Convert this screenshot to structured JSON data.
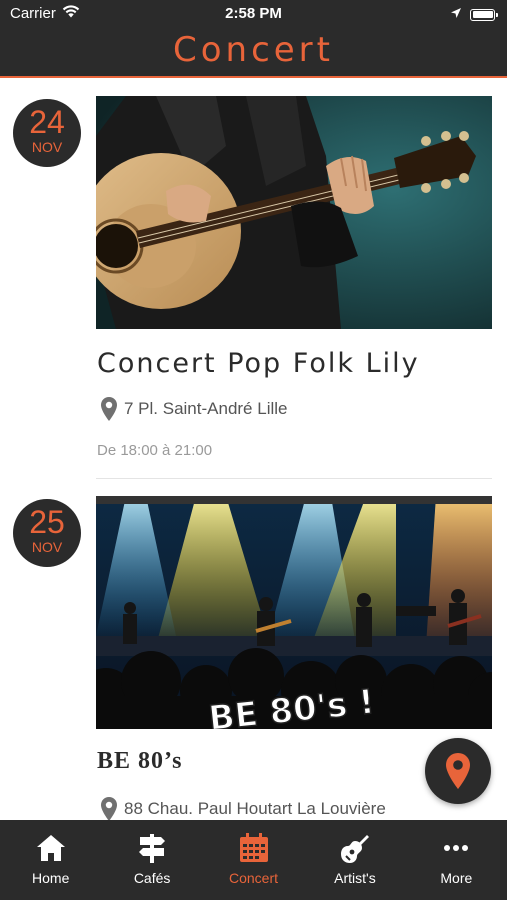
{
  "status_bar": {
    "carrier": "Carrier",
    "time": "2:58 PM"
  },
  "header": {
    "title": "Concert"
  },
  "events": [
    {
      "day": "24",
      "month": "NOV",
      "title": "Concert Pop Folk Lily",
      "address": "7 Pl. Saint-André Lille",
      "time": "De 18:00 à 21:00"
    },
    {
      "day": "25",
      "month": "NOV",
      "title": "BE 80’s",
      "address": "88 Chau. Paul Houtart La Louvière",
      "image_overlay_text": "BE 80's !"
    }
  ],
  "tabbar": {
    "items": [
      {
        "label": "Home",
        "icon": "home-icon"
      },
      {
        "label": "Cafés",
        "icon": "signpost-icon"
      },
      {
        "label": "Concert",
        "icon": "calendar-icon",
        "active": true
      },
      {
        "label": "Artist's",
        "icon": "guitar-icon"
      },
      {
        "label": "More",
        "icon": "more-icon"
      }
    ]
  },
  "colors": {
    "accent": "#e8643a",
    "dark": "#2b2b2b"
  }
}
